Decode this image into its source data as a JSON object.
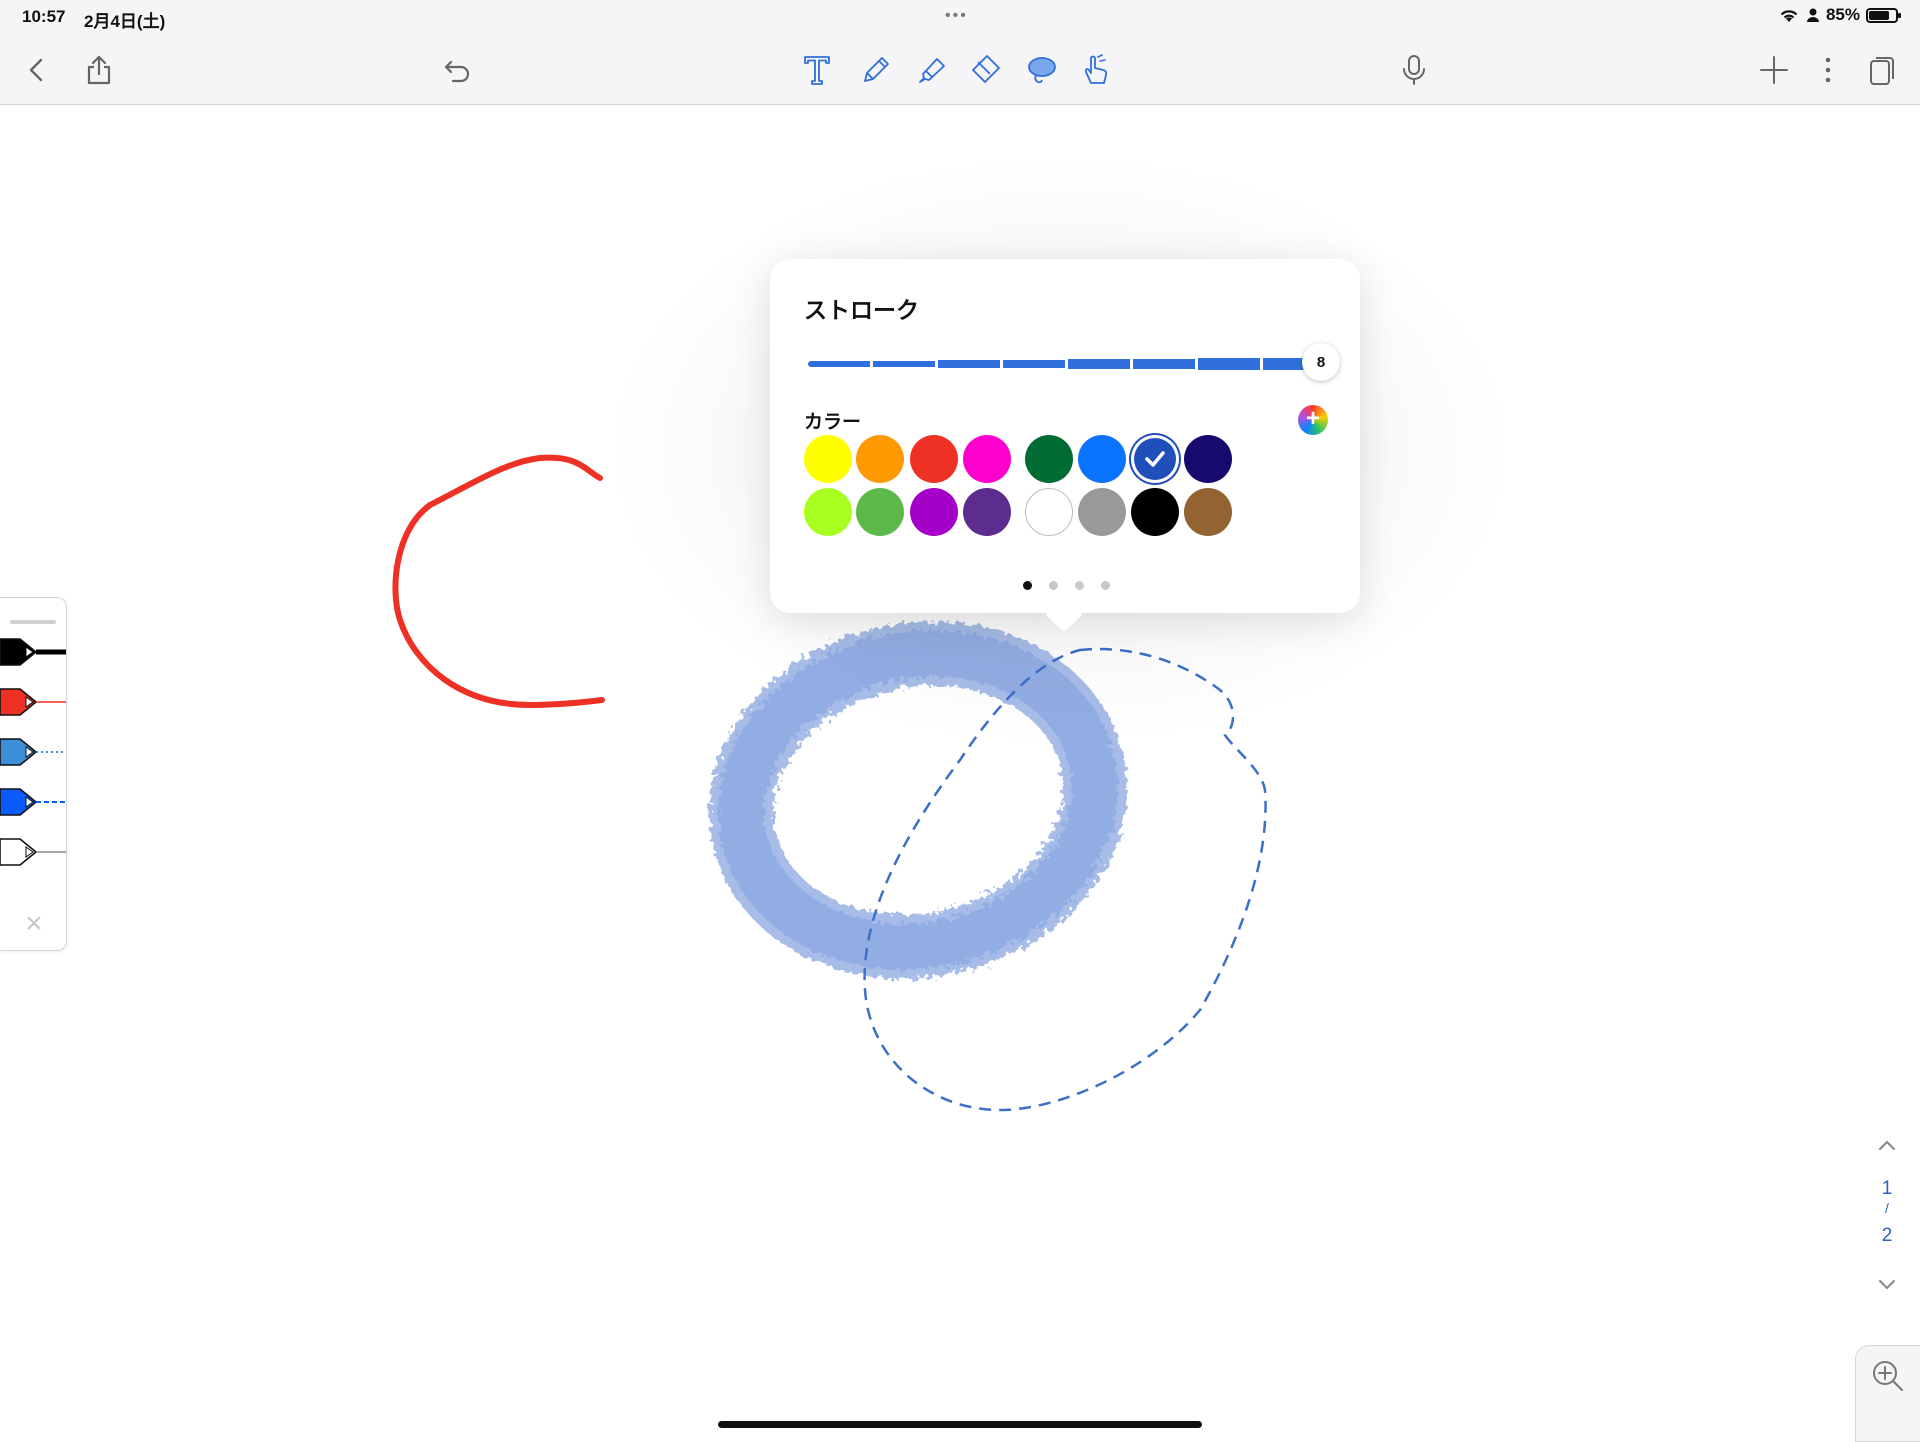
{
  "status_bar": {
    "time": "10:57",
    "date": "2月4日(土)",
    "dots": "•••",
    "battery": "85%",
    "battery_level": 0.85
  },
  "toolbar": {
    "left_icons": [
      "back-chevron-icon",
      "share-icon",
      "undo-icon"
    ],
    "center_tools": [
      "text-tool-icon",
      "pen-tool-icon",
      "highlighter-tool-icon",
      "eraser-tool-icon",
      "lasso-tool-icon",
      "hand-tool-icon"
    ],
    "active_tool": "lasso-tool-icon",
    "right_icons": [
      "microphone-icon",
      "add-icon",
      "more-icon",
      "pages-icon"
    ],
    "accent": "#2f6fdc"
  },
  "pen_dock": {
    "pens": [
      {
        "name": "black-pen",
        "color": "#000000",
        "style": "solid-thick"
      },
      {
        "name": "red-pen",
        "color": "#ee3124",
        "style": "solid-thin"
      },
      {
        "name": "light-blue-pen",
        "color": "#3a8fd8",
        "style": "dotted"
      },
      {
        "name": "blue-pen",
        "color": "#0a5cff",
        "style": "dashed"
      },
      {
        "name": "white-pen",
        "color": "#ffffff",
        "style": "solid-thin"
      }
    ],
    "close_icon": "close-icon"
  },
  "popover": {
    "title": "ストローク",
    "stroke_value": "8",
    "stroke_fraction": 1.0,
    "color_label": "カラー",
    "colors": [
      [
        "#ffff00",
        "#ff9900",
        "#ee3124",
        "#ff00cc",
        "#006b33",
        "#0a74ff",
        "#1f4fb8",
        "#160a6e"
      ],
      [
        "#a6ff1f",
        "#5cb848",
        "#a500c8",
        "#5c2d8f",
        "#ffffff",
        "#999999",
        "#000000",
        "#936432"
      ]
    ],
    "selected": {
      "row": 0,
      "col": 6
    },
    "pages": 4,
    "current_page": 0
  },
  "page_nav": {
    "current": "1",
    "separator": "/",
    "total": "2"
  }
}
